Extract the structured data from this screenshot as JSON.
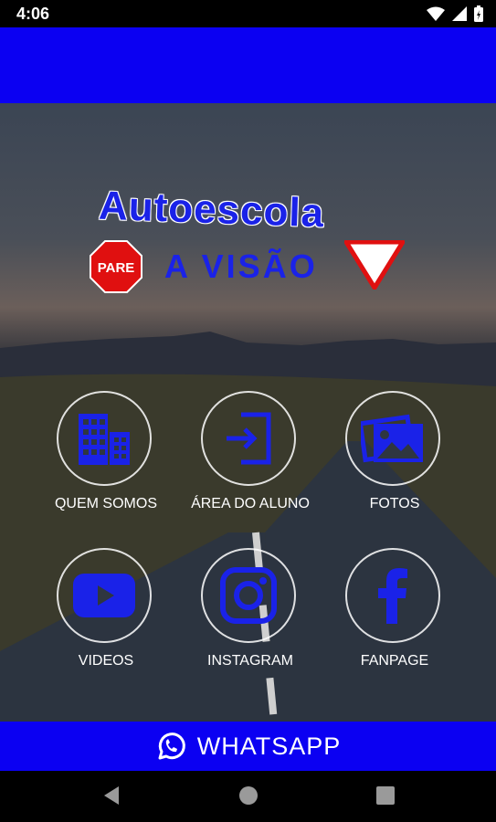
{
  "status_bar": {
    "time": "4:06",
    "icons": [
      "wifi-icon",
      "signal-icon",
      "battery-icon"
    ]
  },
  "logo": {
    "line1": "Autoescola",
    "line2": "A VISÃO",
    "pare_text": "PARE"
  },
  "menu": [
    {
      "id": "quem-somos",
      "label": "QUEM SOMOS",
      "icon": "building-icon"
    },
    {
      "id": "area-aluno",
      "label": "ÁREA DO ALUNO",
      "icon": "login-icon"
    },
    {
      "id": "fotos",
      "label": "FOTOS",
      "icon": "photos-icon"
    },
    {
      "id": "videos",
      "label": "VIDEOS",
      "icon": "youtube-icon"
    },
    {
      "id": "instagram",
      "label": "INSTAGRAM",
      "icon": "instagram-icon"
    },
    {
      "id": "fanpage",
      "label": "FANPAGE",
      "icon": "facebook-icon"
    }
  ],
  "whatsapp": {
    "label": "WHATSAPP"
  },
  "colors": {
    "brand_blue": "#0b00f2",
    "icon_blue": "#1a22e8",
    "pare_red": "#e01010"
  },
  "nav": {
    "icons": [
      "back-icon",
      "home-icon",
      "recents-icon"
    ]
  }
}
